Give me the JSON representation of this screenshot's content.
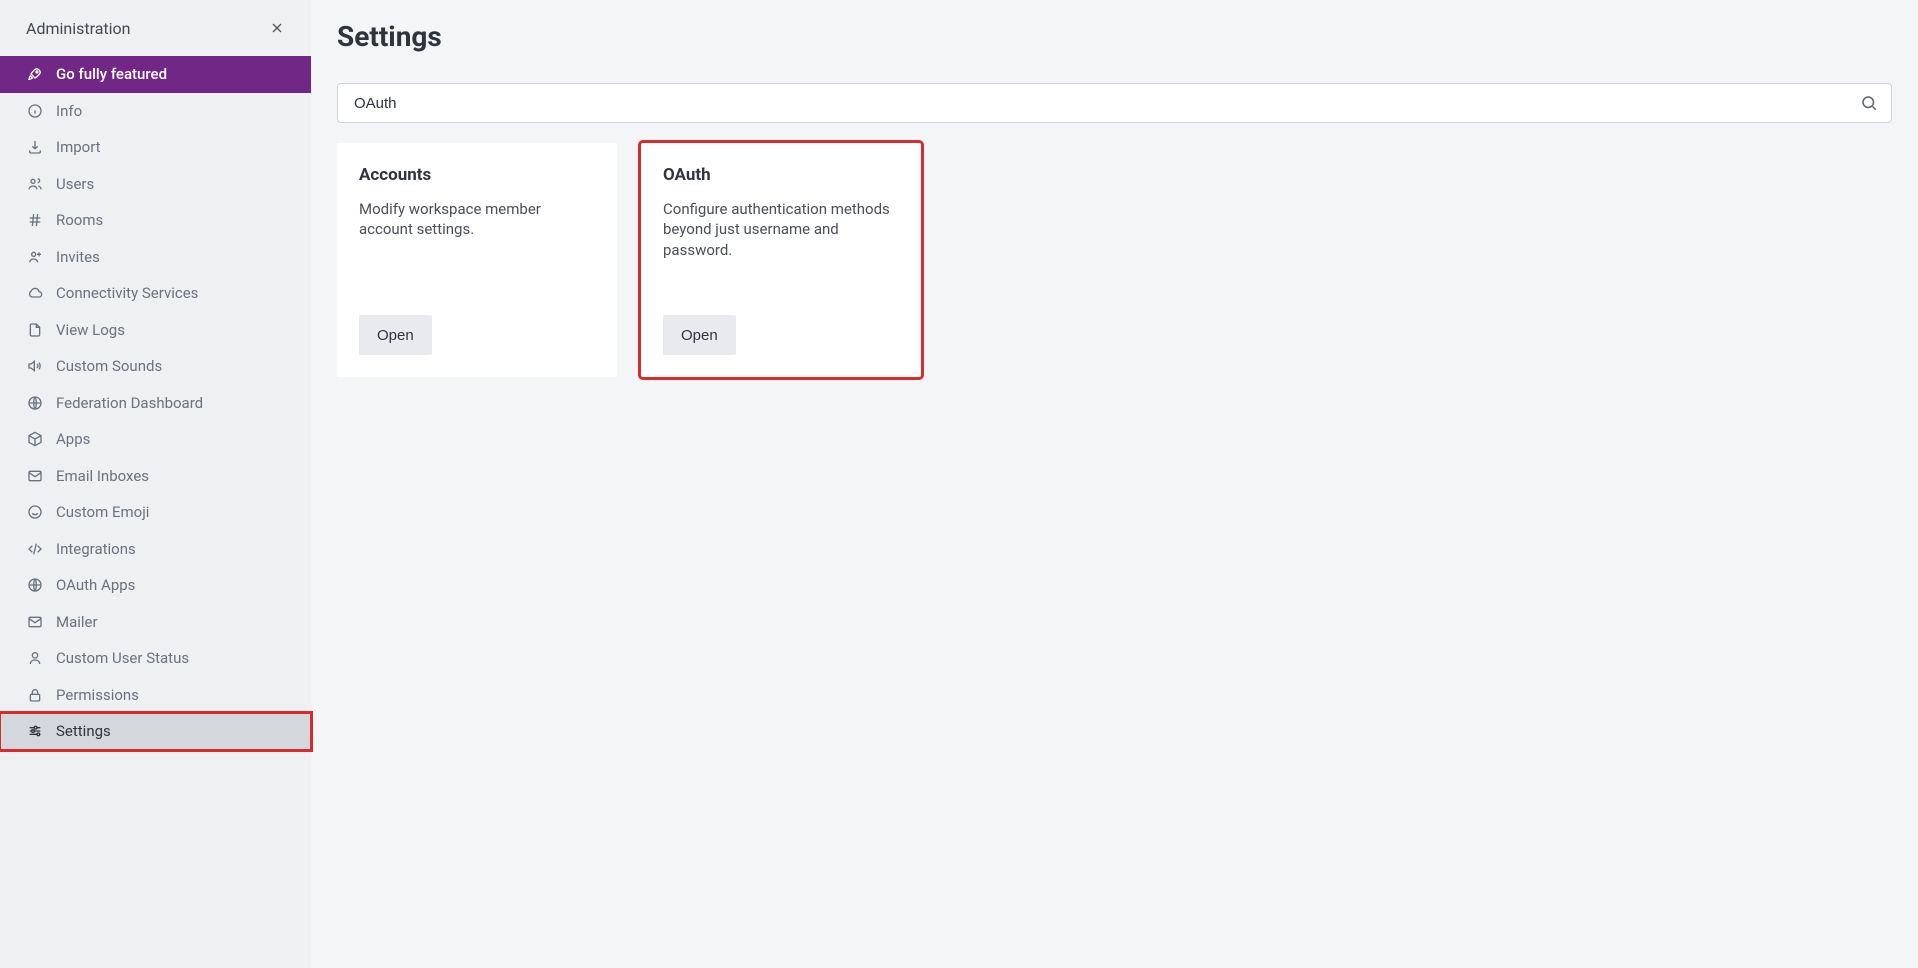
{
  "sidebar": {
    "title": "Administration",
    "upgrade": {
      "label": "Go fully featured"
    },
    "items": [
      {
        "label": "Info"
      },
      {
        "label": "Import"
      },
      {
        "label": "Users"
      },
      {
        "label": "Rooms"
      },
      {
        "label": "Invites"
      },
      {
        "label": "Connectivity Services"
      },
      {
        "label": "View Logs"
      },
      {
        "label": "Custom Sounds"
      },
      {
        "label": "Federation Dashboard"
      },
      {
        "label": "Apps"
      },
      {
        "label": "Email Inboxes"
      },
      {
        "label": "Custom Emoji"
      },
      {
        "label": "Integrations"
      },
      {
        "label": "OAuth Apps"
      },
      {
        "label": "Mailer"
      },
      {
        "label": "Custom User Status"
      },
      {
        "label": "Permissions"
      },
      {
        "label": "Settings"
      }
    ]
  },
  "page": {
    "title": "Settings",
    "search_value": "OAuth"
  },
  "cards": [
    {
      "title": "Accounts",
      "desc": "Modify workspace member account settings.",
      "button": "Open"
    },
    {
      "title": "OAuth",
      "desc": "Configure authentication methods beyond just username and password.",
      "button": "Open"
    }
  ]
}
